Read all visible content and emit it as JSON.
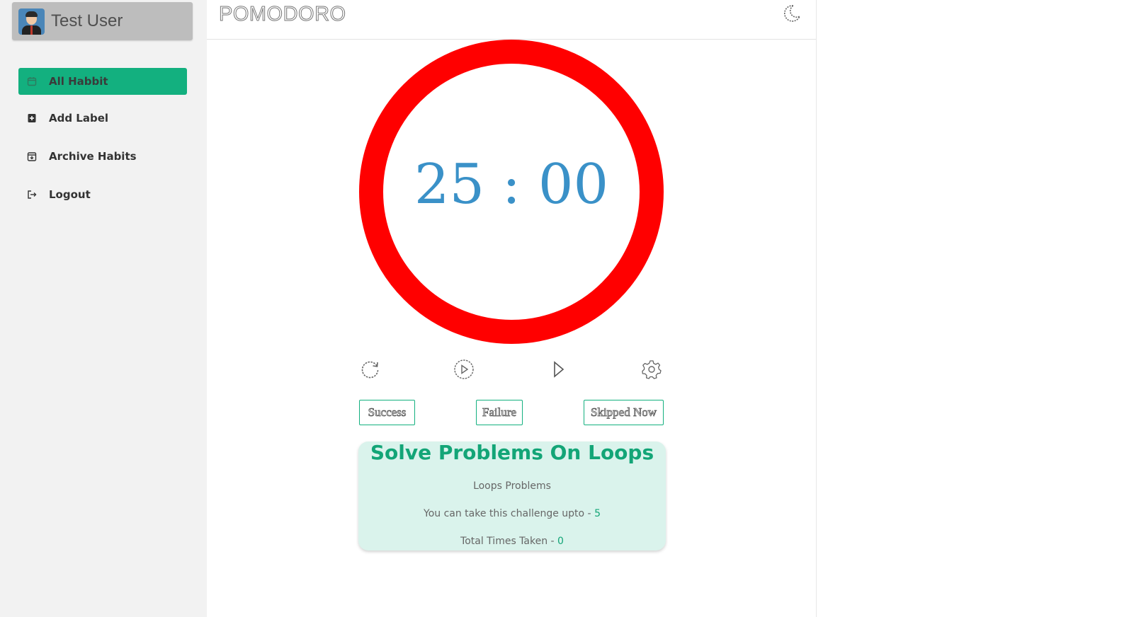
{
  "user": {
    "name": "Test User"
  },
  "sidebar": {
    "items": [
      {
        "label": "All Habbit",
        "icon": "calendar-icon",
        "active": true
      },
      {
        "label": "Add Label",
        "icon": "label-add-icon",
        "active": false
      },
      {
        "label": "Archive Habits",
        "icon": "archive-icon",
        "active": false
      },
      {
        "label": "Logout",
        "icon": "logout-icon",
        "active": false
      }
    ]
  },
  "header": {
    "title": "POMODORO",
    "theme_icon": "moon-icon"
  },
  "timer": {
    "minutes": "25",
    "separator": ":",
    "seconds": "00",
    "display": "25 : 00",
    "ring_color": "#ff0000",
    "text_color": "#3a91c8"
  },
  "controls": [
    {
      "icon": "refresh-icon"
    },
    {
      "icon": "play-circle-icon"
    },
    {
      "icon": "play-icon"
    },
    {
      "icon": "settings-icon"
    }
  ],
  "actions": {
    "success": "Success",
    "failure": "Failure",
    "skipped": "Skipped Now"
  },
  "habit": {
    "title": "Solve Problems On Loops",
    "description": "Loops Problems",
    "limit_label": "You can take this challenge upto -",
    "limit_value": "5",
    "taken_label": "Total Times Taken -",
    "taken_value": "0"
  },
  "colors": {
    "accent": "#13b07f",
    "sidebar_bg": "#f2f2f2",
    "card_bg": "#daf3ec"
  }
}
